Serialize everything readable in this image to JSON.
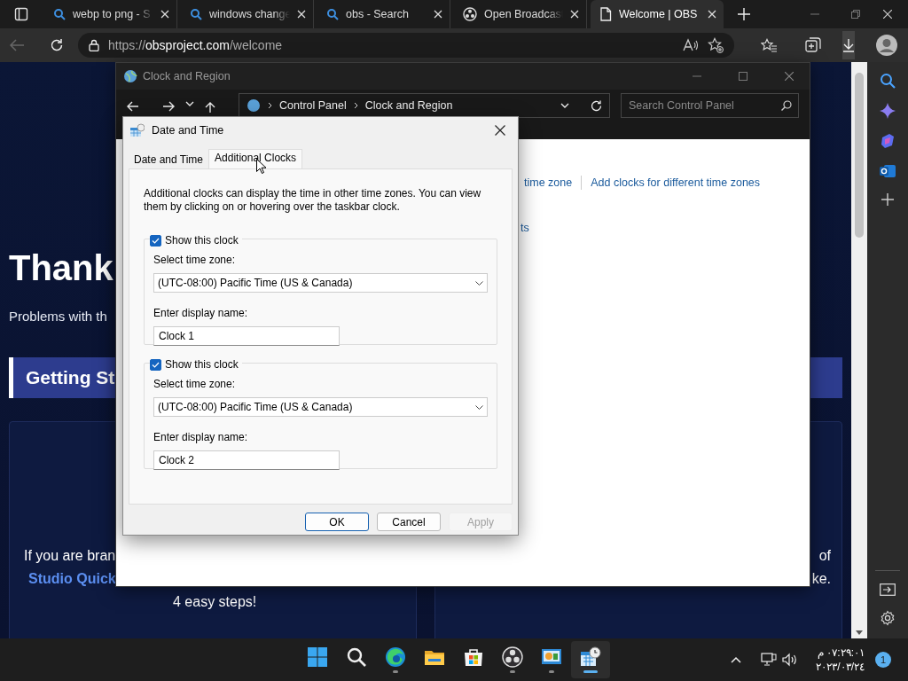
{
  "browser": {
    "tabs": [
      {
        "label": "webp to png - S",
        "kind": "search",
        "selected": false
      },
      {
        "label": "windows change",
        "kind": "search",
        "selected": false
      },
      {
        "label": "obs - Search",
        "kind": "search",
        "selected": false
      },
      {
        "label": "Open Broadcast",
        "kind": "obs",
        "selected": false
      },
      {
        "label": "Welcome | OBS",
        "kind": "page",
        "selected": true
      }
    ],
    "address": {
      "scheme": "https://",
      "domain": "obsproject.com",
      "path": "/welcome"
    }
  },
  "web_page": {
    "heading": "Thank",
    "subtitle": "Problems with th",
    "section_title": "Getting St",
    "left_card": [
      "If you are bran",
      "Studio Quick",
      "4 easy steps!"
    ],
    "right_card": [
      "of",
      "ke."
    ]
  },
  "control_panel": {
    "title": "Clock and Region",
    "breadcrumb": [
      "Control Panel",
      "Clock and Region"
    ],
    "search": {
      "placeholder": "Search Control Panel"
    },
    "links": [
      "time zone",
      "Add clocks for different time zones"
    ],
    "link_fragment": "ts"
  },
  "dialog": {
    "title": "Date and Time",
    "tabs": [
      {
        "label": "Date and Time",
        "selected": false
      },
      {
        "label": "Additional Clocks",
        "selected": true
      }
    ],
    "description": "Additional clocks can display the time in other time zones. You can view them by clicking on or hovering over the taskbar clock.",
    "clocks": [
      {
        "show_label": "Show this clock",
        "checked": true,
        "zone_label": "Select time zone:",
        "zone": "(UTC-08:00) Pacific Time (US & Canada)",
        "name_label": "Enter display name:",
        "name": "Clock 1"
      },
      {
        "show_label": "Show this clock",
        "checked": true,
        "zone_label": "Select time zone:",
        "zone": "(UTC-08:00) Pacific Time (US & Canada)",
        "name_label": "Enter display name:",
        "name": "Clock 2"
      }
    ],
    "buttons": [
      {
        "label": "OK",
        "kind": "default",
        "disabled": false
      },
      {
        "label": "Cancel",
        "kind": "normal",
        "disabled": false
      },
      {
        "label": "Apply",
        "kind": "normal",
        "disabled": true
      }
    ]
  },
  "taskbar": {
    "apps": [
      {
        "kind": "start",
        "running": false,
        "selected": false
      },
      {
        "kind": "search",
        "running": false,
        "selected": false
      },
      {
        "kind": "edge",
        "running": true,
        "selected": false
      },
      {
        "kind": "explorer",
        "running": false,
        "selected": false
      },
      {
        "kind": "store",
        "running": false,
        "selected": false
      },
      {
        "kind": "obs",
        "running": true,
        "selected": false
      },
      {
        "kind": "controlpanel",
        "running": true,
        "selected": false
      },
      {
        "kind": "datetime",
        "running": true,
        "selected": true
      }
    ],
    "time": "٠٧:٢٩:٠١ م",
    "date": "٢٠٢٣/٠٣/٢٤",
    "notifications": "1"
  }
}
